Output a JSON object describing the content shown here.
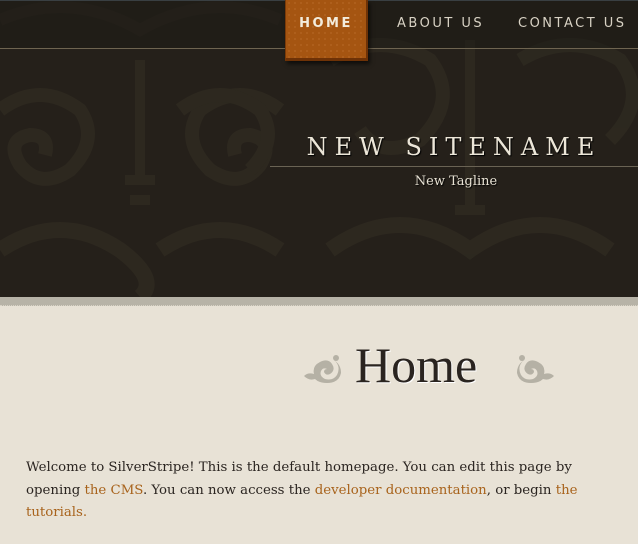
{
  "nav": {
    "items": [
      {
        "label": "HOME",
        "active": true
      },
      {
        "label": "ABOUT US",
        "active": false
      },
      {
        "label": "CONTACT US",
        "active": false
      }
    ]
  },
  "header": {
    "site_name": "NEW SITENAME",
    "tagline": "New Tagline"
  },
  "page": {
    "title": "Home",
    "content": {
      "t1": "Welcome to SilverStripe! This is the default homepage. You can edit this page by opening ",
      "link1": "the CMS",
      "t2": ". You can now access the ",
      "link2": "developer documentation",
      "t3": ", or begin ",
      "link3": "the tutorials."
    }
  },
  "colors": {
    "accent": "#a55511",
    "link": "#a8631c",
    "header_bg": "#25201a",
    "page_bg": "#e8e2d6"
  }
}
